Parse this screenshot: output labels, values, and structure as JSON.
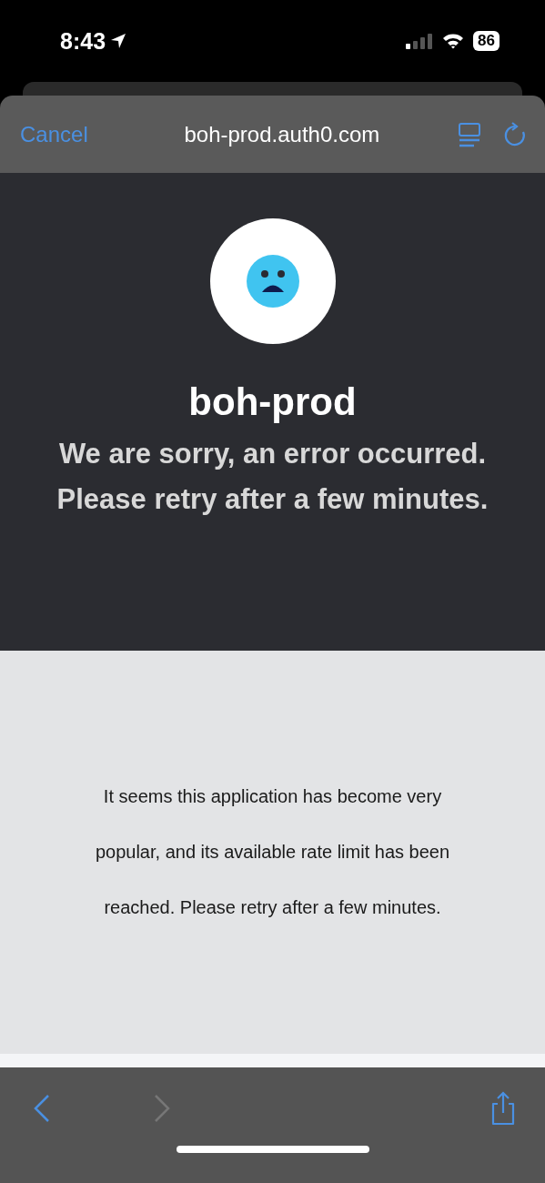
{
  "status_bar": {
    "time": "8:43",
    "battery": "86"
  },
  "nav": {
    "cancel": "Cancel",
    "title": "boh-prod.auth0.com"
  },
  "error_page": {
    "app_name": "boh-prod",
    "heading_lines": [
      "We are sorry, an error occurred.",
      "Please retry after a few minutes."
    ],
    "message": "It seems this application has become very popular, and its available rate limit has been reached. Please retry after a few minutes."
  },
  "toolbar": {
    "back_disabled": false,
    "forward_disabled": true
  }
}
